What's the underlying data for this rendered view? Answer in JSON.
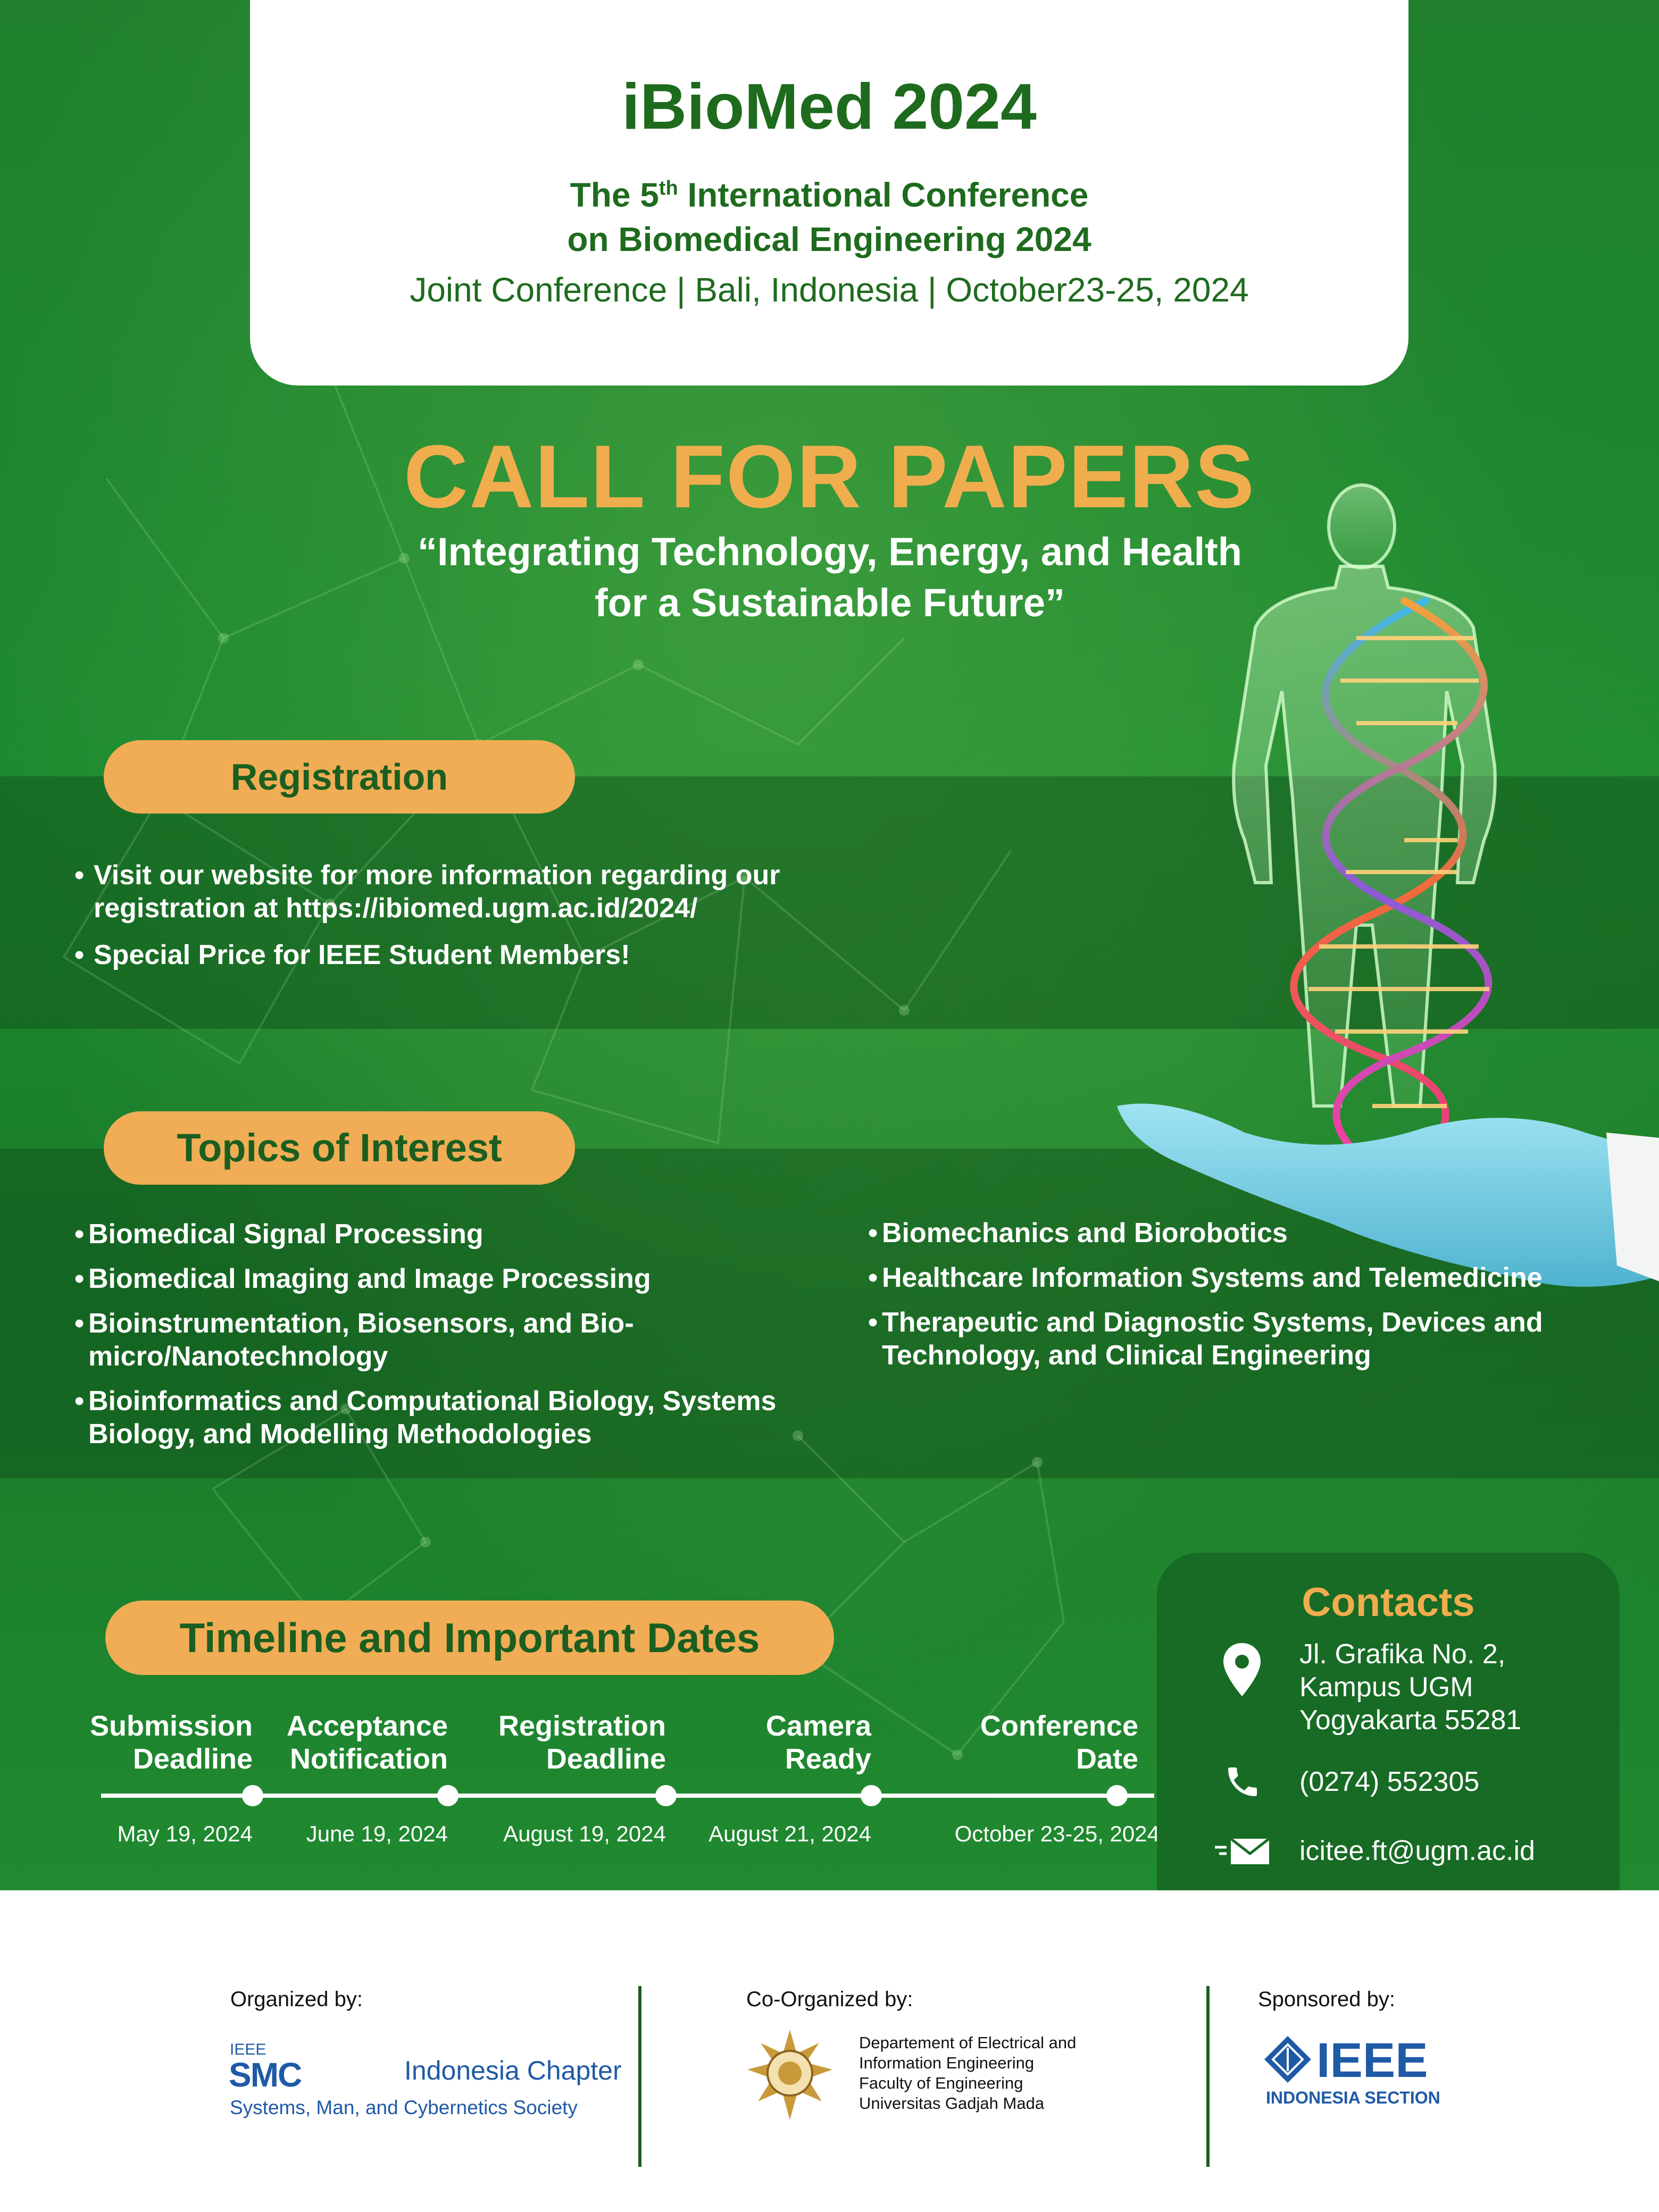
{
  "header": {
    "title": "iBioMed 2024",
    "subtitle_line1_pre": "The 5",
    "subtitle_line1_sup": "th",
    "subtitle_line1_post": " International Conference",
    "subtitle_line2": "on Biomedical Engineering 2024",
    "joint": "Joint Conference | Bali, Indonesia | October23-25, 2024"
  },
  "call_for_papers": "CALL FOR PAPERS",
  "theme": "“Integrating Technology, Energy, and Health for a Sustainable Future”",
  "registration": {
    "heading": "Registration",
    "items": [
      "Visit our website for more information regarding our registration at https://ibiomed.ugm.ac.id/2024/",
      "Special Price for IEEE Student Members!"
    ]
  },
  "topics": {
    "heading": "Topics of Interest",
    "left": [
      "Biomedical Signal Processing",
      "Biomedical Imaging and Image Processing",
      "Bioinstrumentation, Biosensors, and Bio-micro/Nanotechnology",
      "Bioinformatics and Computational Biology, Systems Biology, and Modelling Methodologies"
    ],
    "right": [
      "Biomechanics and Biorobotics",
      "Healthcare Information Systems and Telemedicine",
      "Therapeutic and Diagnostic Systems, Devices and Technology, and Clinical Engineering"
    ]
  },
  "timeline": {
    "heading": "Timeline and Important Dates",
    "items": [
      {
        "label_1": "Submission",
        "label_2": "Deadline",
        "date": "May 19, 2024"
      },
      {
        "label_1": "Acceptance",
        "label_2": "Notification",
        "date": "June 19, 2024"
      },
      {
        "label_1": "Registration",
        "label_2": "Deadline",
        "date": "August 19, 2024"
      },
      {
        "label_1": "Camera",
        "label_2": "Ready",
        "date": "August 21, 2024"
      },
      {
        "label_1": "Conference",
        "label_2": "Date",
        "date": "October 23-25, 2024"
      }
    ]
  },
  "contacts": {
    "heading": "Contacts",
    "address_1": "Jl. Grafika No. 2,",
    "address_2": "Kampus UGM",
    "address_3": "Yogyakarta 55281",
    "phone": "(0274) 552305",
    "email": "icitee.ft@ugm.ac.id"
  },
  "footer": {
    "organized_by": "Organized by:",
    "co_organized_by": "Co-Organized by:",
    "sponsored_by": "Sponsored by:",
    "smc_ieee": "IEEE",
    "smc": "SMC",
    "smc_chapter": "Indonesia Chapter",
    "smc_society": "Systems, Man, and Cybernetics Society",
    "dept_1": "Departement of Electrical and",
    "dept_2": "Information Engineering",
    "dept_3": "Faculty of Engineering",
    "dept_4": "Universitas Gadjah Mada",
    "ieee": "IEEE",
    "ieee_section": "INDONESIA SECTION"
  },
  "colors": {
    "green_dark": "#1e6b1e",
    "green_bg": "#1d8a2f",
    "orange": "#f0ad4e",
    "ieee_blue": "#1f5aa6"
  }
}
